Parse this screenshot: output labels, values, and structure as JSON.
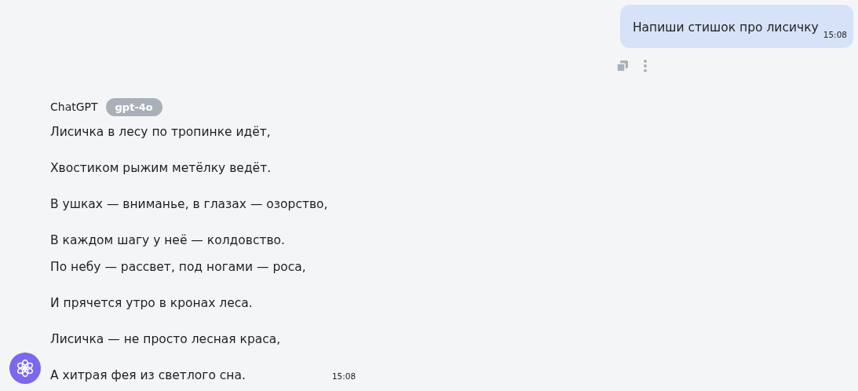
{
  "user_message": {
    "text": "Напиши стишок про лисичку",
    "time": "15:08"
  },
  "assistant_message": {
    "sender": "ChatGPT",
    "model_badge": "gpt-4o",
    "time": "15:08",
    "paragraphs": [
      [
        "Лисичка в лесу по тропинке идёт,"
      ],
      [
        "Хвостиком рыжим метёлку ведёт."
      ],
      [
        "В ушках — вниманье, в глазах — озорство,"
      ],
      [
        "В каждом шагу у неё — колдовство.",
        "По небу — рассвет, под ногами — роса,"
      ],
      [
        "И прячется утро в кронах леса."
      ],
      [
        "Лисичка — не просто лесная краса,"
      ],
      [
        "А хитрая фея из светлого сна."
      ]
    ]
  }
}
